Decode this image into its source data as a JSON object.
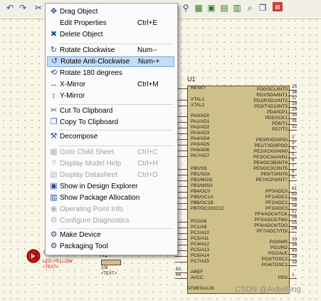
{
  "menu": {
    "items": [
      {
        "icon": "move-icon",
        "label": "Drag Object",
        "shortcut": "",
        "disabled": false,
        "highlight": false
      },
      {
        "icon": "",
        "label": "Edit Properties",
        "shortcut": "Ctrl+E",
        "disabled": false,
        "highlight": false
      },
      {
        "icon": "delete-icon",
        "label": "Delete Object",
        "shortcut": "",
        "disabled": false,
        "highlight": false
      },
      {
        "icon": "rotate-cw-icon",
        "label": "Rotate Clockwise",
        "shortcut": "Num--",
        "disabled": false,
        "highlight": false
      },
      {
        "icon": "rotate-ccw-icon",
        "label": "Rotate Anti-Clockwise",
        "shortcut": "Num-+",
        "disabled": false,
        "highlight": true
      },
      {
        "icon": "rotate-180-icon",
        "label": "Rotate 180 degrees",
        "shortcut": "",
        "disabled": false,
        "highlight": false
      },
      {
        "icon": "x-mirror-icon",
        "label": "X-Mirror",
        "shortcut": "Ctrl+M",
        "disabled": false,
        "highlight": false
      },
      {
        "icon": "y-mirror-icon",
        "label": "Y-Mirror",
        "shortcut": "",
        "disabled": false,
        "highlight": false
      },
      {
        "icon": "cut-icon",
        "label": "Cut To Clipboard",
        "shortcut": "",
        "disabled": false,
        "highlight": false
      },
      {
        "icon": "copy-icon",
        "label": "Copy To Clipboard",
        "shortcut": "",
        "disabled": false,
        "highlight": false
      },
      {
        "icon": "decompose-icon",
        "label": "Decompose",
        "shortcut": "",
        "disabled": false,
        "highlight": false
      },
      {
        "icon": "goto-child-icon",
        "label": "Goto Child Sheet",
        "shortcut": "Ctrl+C",
        "disabled": true,
        "highlight": false
      },
      {
        "icon": "model-help-icon",
        "label": "Display Model Help",
        "shortcut": "Ctrl+H",
        "disabled": true,
        "highlight": false
      },
      {
        "icon": "datasheet-icon",
        "label": "Display Datasheet",
        "shortcut": "Ctrl+D",
        "disabled": true,
        "highlight": false
      },
      {
        "icon": "design-explorer-icon",
        "label": "Show in Design Explorer",
        "shortcut": "",
        "disabled": false,
        "highlight": false
      },
      {
        "icon": "package-icon",
        "label": "Show Package Allocation",
        "shortcut": "",
        "disabled": false,
        "highlight": false
      },
      {
        "icon": "operating-point-icon",
        "label": "Operating Point Info",
        "shortcut": "",
        "disabled": true,
        "highlight": false
      },
      {
        "icon": "diagnostics-icon",
        "label": "Configure Diagnostics",
        "shortcut": "",
        "disabled": true,
        "highlight": false
      },
      {
        "icon": "make-device-icon",
        "label": "Make Device",
        "shortcut": "",
        "disabled": false,
        "highlight": false
      },
      {
        "icon": "packaging-tool-icon",
        "label": "Packaging Tool",
        "shortcut": "",
        "disabled": false,
        "highlight": false
      }
    ]
  },
  "chip": {
    "ref": "U1",
    "part": "ATMEGA128",
    "left_pins": [
      "RESET",
      "XTAL1",
      "XTAL2",
      "PA0/AD0",
      "PA1/AD1",
      "PA2/AD2",
      "PA3/AD3",
      "PA4/AD4",
      "PA5/AD5",
      "PA6/AD6",
      "PA7/AD7",
      "PB0/SS",
      "PB1/SCK",
      "PB2/MOSI",
      "PB3/MISO",
      "PB4/OC0",
      "PB5/OC1A",
      "PB6/OC1B",
      "PB7/OC2/OC1C",
      "PC0/A8",
      "PC1/A9",
      "PC2/A10",
      "PC3/A11",
      "PC4/A12",
      "PC5/A13",
      "PC6/A14",
      "PC7/A15",
      "AREF",
      "AVCC"
    ],
    "right_pins": [
      "PD0/SCL/INT0",
      "PD1/SDA/INT1",
      "PD2/RXD1/INT2",
      "PD3/TXD1/INT3",
      "PD4/ICP1",
      "PD5/XCK1",
      "PD6/T1",
      "PD7/T2",
      "PE0/RXD0/PDI",
      "PE1/TXD0/PDO",
      "PE2/XCK0/AIN0",
      "PE3/OC3A/AIN1",
      "PE4/OC3B/INT4",
      "PE5/OC3C/INT5",
      "PE6/T3/INT6",
      "PE7/ICP3/INT7",
      "PF0/ADC0",
      "PF1/ADC1",
      "PF2/ADC2",
      "PF3/ADC3",
      "PF4/ADC4/TCK",
      "PF5/ADC5/TMS",
      "PF6/ADC6/TDO",
      "PF7/ADC7/TDI",
      "PG0/WR",
      "PG1/RD",
      "PG2/ALE",
      "PG3/TOSC2",
      "PG4/TOSC1",
      "PEN"
    ],
    "right_numbers": [
      "25",
      "26",
      "27",
      "28",
      "29",
      "30",
      "31",
      "32",
      "2",
      "3",
      "4",
      "5",
      "6",
      "7",
      "8",
      "9",
      "61",
      "60",
      "59",
      "58",
      "57",
      "56",
      "55",
      "54",
      "33",
      "34",
      "43",
      "18",
      "19",
      "1"
    ],
    "left_numbers": [
      "62",
      "64"
    ]
  },
  "components": {
    "led_ref": "D",
    "led_name": "LED-YELLOW",
    "led_text": "<TEXT>",
    "res_ref": "R1",
    "res_value": "10k",
    "res_text": "<TEXT>"
  },
  "watermark": "CSDN @Axbolljing",
  "colors": {
    "toolbar": "#f1efe6",
    "canvas": "#f7f6e7",
    "highlight": "#c5dcf6",
    "chip_fill": "#cfc08a",
    "chip_border": "#6b3f3f",
    "led": "#d01010"
  }
}
